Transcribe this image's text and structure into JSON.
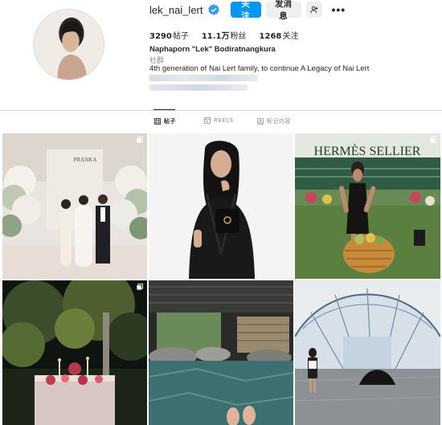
{
  "profile": {
    "username": "lek_nai_lert",
    "follow_label": "关注",
    "message_label": "发消息",
    "more_glyph": "•••",
    "full_name": "Naphaporn \"Lek\" Bodiratnangkura",
    "category": "社群",
    "bio": "4th generation of Nai Lert family, to continue A Legacy of Nai Lert"
  },
  "stats": {
    "posts_count": "3290",
    "posts_label": "帖子",
    "followers_count": "11.1万",
    "followers_label": "粉丝",
    "following_count": "1268",
    "following_label": "关注"
  },
  "tabs": [
    {
      "label": "帖子",
      "icon": "grid-icon",
      "active": true
    },
    {
      "label": "REELS",
      "icon": "reels-icon",
      "active": false
    },
    {
      "label": "标记内容",
      "icon": "tagged-icon",
      "active": false
    }
  ],
  "posts": [
    {
      "alt": "wedding-ceremony",
      "multi": true,
      "banner_text": "PRANKA"
    },
    {
      "alt": "portrait-black-robe",
      "multi": false
    },
    {
      "alt": "hermes-sellier-garden",
      "multi": true,
      "banner_text": "HERMÈS SELLIER"
    },
    {
      "alt": "night-garden-dinner",
      "multi": true
    },
    {
      "alt": "onsen-pool",
      "multi": false
    },
    {
      "alt": "greenhouse-walk",
      "multi": false
    }
  ],
  "colors": {
    "accent": "#0095f6",
    "verified": "#3897f0",
    "secondary_text": "#8e8e8e"
  }
}
